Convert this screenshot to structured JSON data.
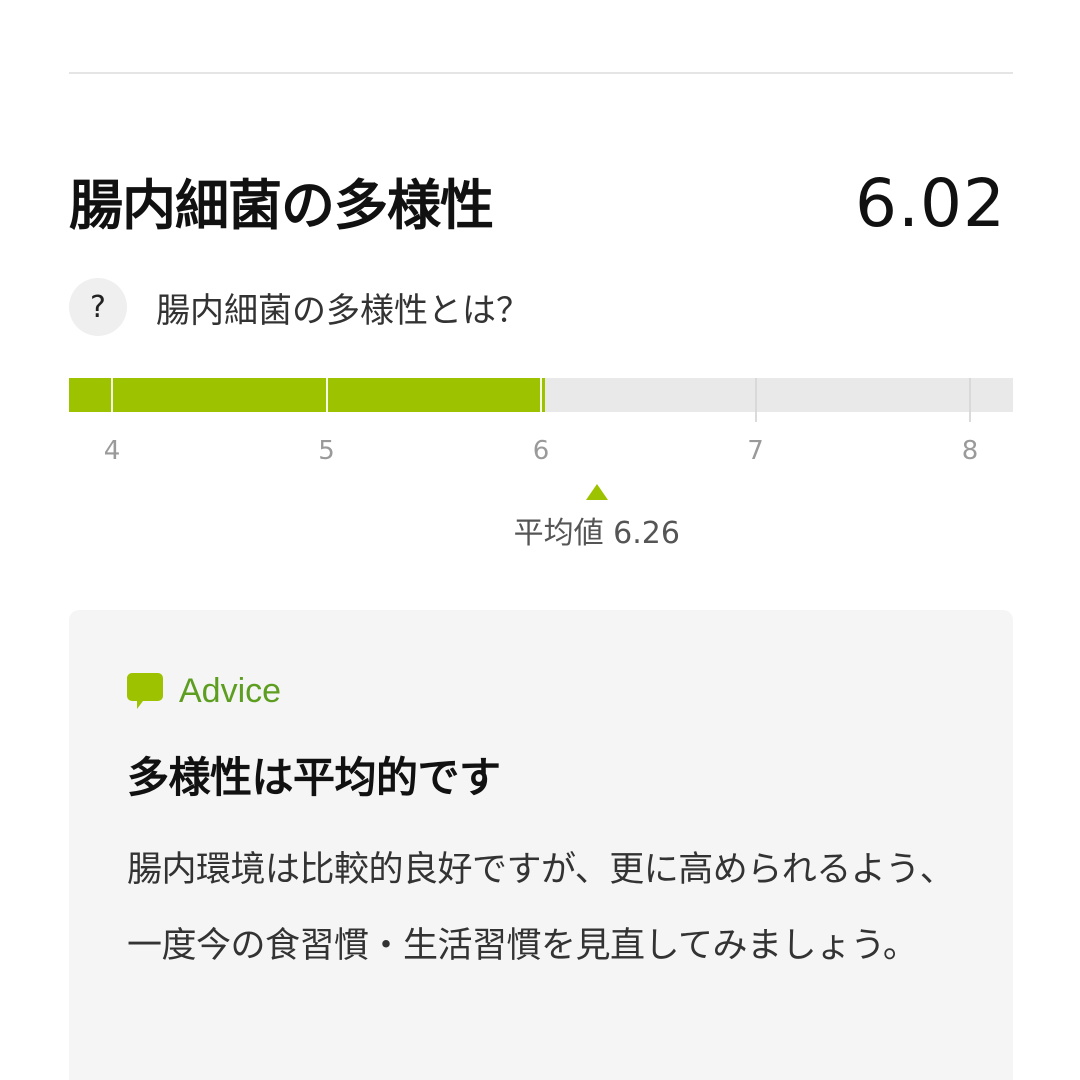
{
  "metric": {
    "title": "腸内細菌の多様性",
    "value": "6.02",
    "help_label": "腸内細菌の多様性とは？",
    "help_icon": "question-icon",
    "help_symbol": "?"
  },
  "scale": {
    "min": 4,
    "max": 8,
    "ticks": [
      "4",
      "5",
      "6",
      "7",
      "8"
    ],
    "current": 6.02,
    "average": 6.26,
    "average_label": "平均値 6.26",
    "fill_color": "#9dc300",
    "track_color": "#e9e9e9"
  },
  "advice": {
    "label": "Advice",
    "icon": "speech-bubble-icon",
    "accent_color": "#5d9e20",
    "title": "多様性は平均的です",
    "body": "腸内環境は比較的良好ですが、更に高められるよう、一度今の食習慣・生活習慣を見直してみましょう。"
  }
}
